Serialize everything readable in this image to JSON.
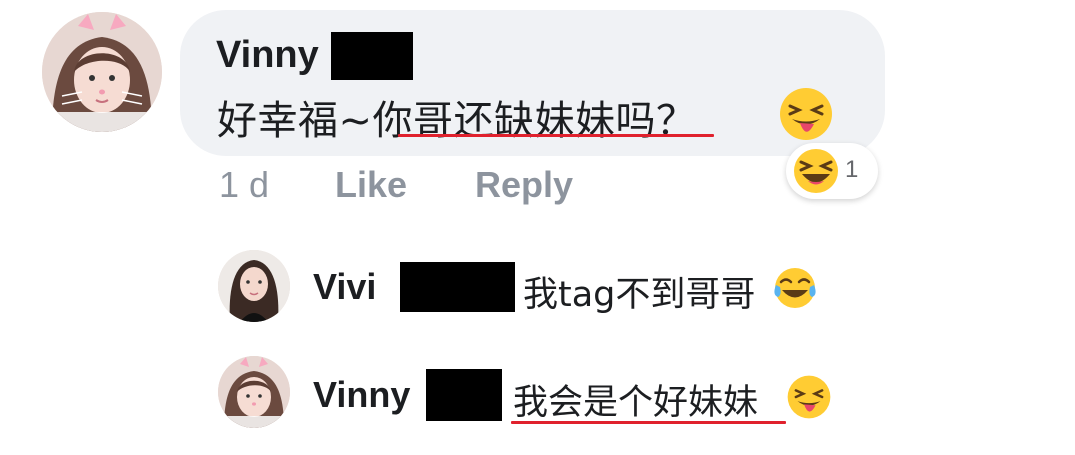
{
  "comment": {
    "author": "Vinny",
    "text": "好幸福~你哥还缺妹妹吗？",
    "time": "1 d",
    "like_label": "Like",
    "reply_label": "Reply",
    "reaction_count": "1",
    "reaction_icon": "laughing-emoji",
    "trailing_emoji": "squinting-tongue-emoji"
  },
  "replies": [
    {
      "author": "Vivi",
      "text": "我tag不到哥哥",
      "emoji": "tears-of-joy-emoji"
    },
    {
      "author": "Vinny",
      "text": "我会是个好妹妹",
      "emoji": "squinting-tongue-emoji"
    }
  ],
  "colors": {
    "bubble": "#f0f2f5",
    "underline": "#e0212d",
    "meta_text": "#8d949e",
    "redaction": "#000000"
  }
}
